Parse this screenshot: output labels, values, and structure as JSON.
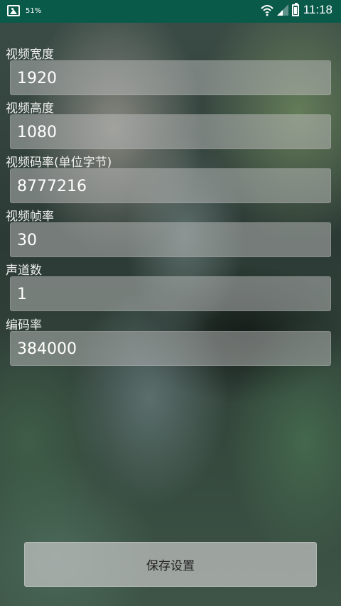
{
  "status_bar": {
    "battery_percent": "51%",
    "time": "11:18",
    "icons": [
      "image-icon",
      "wifi-icon",
      "signal-icon",
      "battery-icon"
    ],
    "background_color": "#0a5a4a"
  },
  "fields": [
    {
      "label": "视频宽度",
      "value": "1920"
    },
    {
      "label": "视频高度",
      "value": "1080"
    },
    {
      "label": "视频码率(单位字节)",
      "value": "8777216"
    },
    {
      "label": "视频帧率",
      "value": "30"
    },
    {
      "label": "声道数",
      "value": "1"
    },
    {
      "label": "编码率",
      "value": "384000"
    }
  ],
  "save_button_label": "保存设置"
}
